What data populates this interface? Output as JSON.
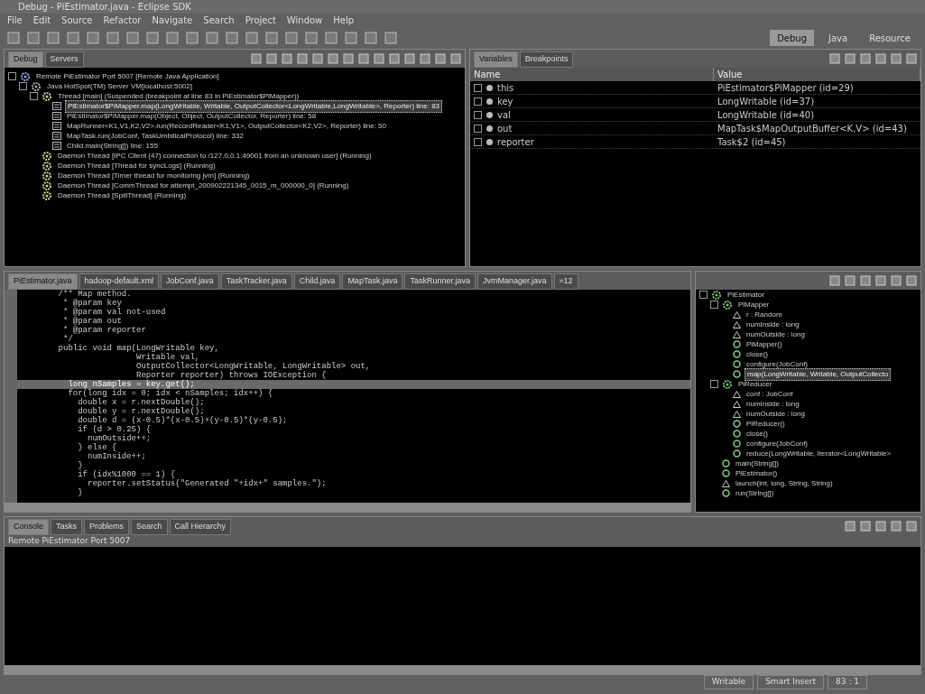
{
  "window": {
    "title": "Debug - PiEstimator.java - Eclipse SDK"
  },
  "menu": [
    "File",
    "Edit",
    "Source",
    "Refactor",
    "Navigate",
    "Search",
    "Project",
    "Window",
    "Help"
  ],
  "perspectives": [
    {
      "label": "Debug",
      "selected": true
    },
    {
      "label": "Java",
      "selected": false
    },
    {
      "label": "Resource",
      "selected": false
    }
  ],
  "debug_view": {
    "tabs": [
      {
        "label": "Debug",
        "selected": true
      },
      {
        "label": "Servers",
        "selected": false
      }
    ],
    "tree": [
      {
        "kind": "launch",
        "text": "Remote PiEstimator Port 5007 [Remote Java Application]",
        "selected": false,
        "children": [
          {
            "kind": "vm",
            "text": "Java HotSpot(TM) Server VM[localhost:5002]",
            "selected": false,
            "children": [
              {
                "kind": "thread",
                "text": "Thread [main] (Suspended (breakpoint at line 83 in PiEstimator$PiMapper))",
                "selected": false,
                "children": [
                  {
                    "kind": "frame",
                    "text": "PiEstimator$PiMapper.map(LongWritable, Writable, OutputCollector<LongWritable,LongWritable>, Reporter) line: 83",
                    "selected": true
                  },
                  {
                    "kind": "frame",
                    "text": "PiEstimator$PiMapper.map(Object, Object, OutputCollector, Reporter) line: 58",
                    "selected": false
                  },
                  {
                    "kind": "frame",
                    "text": "MapRunner<K1,V1,K2,V2>.run(RecordReader<K1,V1>, OutputCollector<K2,V2>, Reporter) line: 50",
                    "selected": false
                  },
                  {
                    "kind": "frame",
                    "text": "MapTask.run(JobConf, TaskUmbilicalProtocol) line: 332",
                    "selected": false
                  },
                  {
                    "kind": "frame",
                    "text": "Child.main(String[]) line: 155",
                    "selected": false
                  }
                ]
              },
              {
                "kind": "thread",
                "text": "Daemon Thread [IPC Client (47) connection to /127.0.0.1:49001 from an unknown user] (Running)",
                "selected": false
              },
              {
                "kind": "thread",
                "text": "Daemon Thread [Thread for syncLogs] (Running)",
                "selected": false
              },
              {
                "kind": "thread",
                "text": "Daemon Thread [Timer thread for monitoring jvm] (Running)",
                "selected": false
              },
              {
                "kind": "thread",
                "text": "Daemon Thread [CommThread for attempt_200902221345_0015_m_000000_0] (Running)",
                "selected": false
              },
              {
                "kind": "thread",
                "text": "Daemon Thread [SpillThread] (Running)",
                "selected": false
              }
            ]
          }
        ]
      }
    ]
  },
  "variables_view": {
    "tabs": [
      {
        "label": "Variables",
        "selected": true
      },
      {
        "label": "Breakpoints",
        "selected": false
      }
    ],
    "columns": [
      "Name",
      "Value"
    ],
    "rows": [
      {
        "name": "this",
        "value": "PiEstimator$PiMapper (id=29)"
      },
      {
        "name": "key",
        "value": "LongWritable (id=37)"
      },
      {
        "name": "val",
        "value": "LongWritable (id=40)"
      },
      {
        "name": "out",
        "value": "MapTask$MapOutputBuffer<K,V> (id=43)"
      },
      {
        "name": "reporter",
        "value": "Task$2 (id=45)"
      }
    ]
  },
  "editor": {
    "tabs": [
      {
        "label": "PiEstimator.java",
        "selected": true
      },
      {
        "label": "hadoop-default.xml",
        "selected": false
      },
      {
        "label": "JobConf.java",
        "selected": false
      },
      {
        "label": "TaskTracker.java",
        "selected": false
      },
      {
        "label": "Child.java",
        "selected": false
      },
      {
        "label": "MapTask.java",
        "selected": false
      },
      {
        "label": "TaskRunner.java",
        "selected": false
      },
      {
        "label": "JvmManager.java",
        "selected": false
      },
      {
        "label": "»12",
        "selected": false
      }
    ],
    "lines": [
      {
        "text": "    /** Map method.",
        "current": false
      },
      {
        "text": "     * @param key",
        "current": false
      },
      {
        "text": "     * @param val not-used",
        "current": false
      },
      {
        "text": "     * @param out",
        "current": false
      },
      {
        "text": "     * @param reporter",
        "current": false
      },
      {
        "text": "     */",
        "current": false
      },
      {
        "text": "    public void map(LongWritable key,",
        "current": false
      },
      {
        "text": "                    Writable val,",
        "current": false
      },
      {
        "text": "                    OutputCollector<LongWritable, LongWritable> out,",
        "current": false
      },
      {
        "text": "                    Reporter reporter) throws IOException {",
        "current": false
      },
      {
        "text": "      long nSamples = key.get();",
        "current": true
      },
      {
        "text": "      for(long idx = 0; idx < nSamples; idx++) {",
        "current": false
      },
      {
        "text": "        double x = r.nextDouble();",
        "current": false
      },
      {
        "text": "        double y = r.nextDouble();",
        "current": false
      },
      {
        "text": "        double d = (x-0.5)*(x-0.5)+(y-0.5)*(y-0.5);",
        "current": false
      },
      {
        "text": "        if (d > 0.25) {",
        "current": false
      },
      {
        "text": "          numOutside++;",
        "current": false
      },
      {
        "text": "        } else {",
        "current": false
      },
      {
        "text": "          numInside++;",
        "current": false
      },
      {
        "text": "        }",
        "current": false
      },
      {
        "text": "        if (idx%1000 == 1) {",
        "current": false
      },
      {
        "text": "          reporter.setStatus(\"Generated \"+idx+\" samples.\");",
        "current": false
      },
      {
        "text": "        }",
        "current": false
      }
    ]
  },
  "outline": {
    "tree": [
      {
        "kind": "class",
        "text": "PiEstimator",
        "selected": false,
        "children": [
          {
            "kind": "class",
            "text": "PiMapper",
            "selected": false,
            "children": [
              {
                "kind": "field",
                "text": "r : Random",
                "selected": false
              },
              {
                "kind": "field",
                "text": "numInside : long",
                "selected": false
              },
              {
                "kind": "field",
                "text": "numOutside : long",
                "selected": false
              },
              {
                "kind": "method",
                "text": "PiMapper()",
                "selected": false
              },
              {
                "kind": "method",
                "text": "close()",
                "selected": false
              },
              {
                "kind": "method",
                "text": "configure(JobConf)",
                "selected": false
              },
              {
                "kind": "method",
                "text": "map(LongWritable, Writable, OutputCollecto",
                "selected": true
              }
            ]
          },
          {
            "kind": "class",
            "text": "PiReducer",
            "selected": false,
            "children": [
              {
                "kind": "field",
                "text": "conf : JobConf",
                "selected": false
              },
              {
                "kind": "field",
                "text": "numInside : long",
                "selected": false
              },
              {
                "kind": "field",
                "text": "numOutside : long",
                "selected": false
              },
              {
                "kind": "method",
                "text": "PiReducer()",
                "selected": false
              },
              {
                "kind": "method",
                "text": "close()",
                "selected": false
              },
              {
                "kind": "method",
                "text": "configure(JobConf)",
                "selected": false
              },
              {
                "kind": "method",
                "text": "reduce(LongWritable, Iterator<LongWritable>",
                "selected": false
              }
            ]
          },
          {
            "kind": "method",
            "text": "main(String[])",
            "selected": false
          },
          {
            "kind": "method",
            "text": "PiEstimator()",
            "selected": false
          },
          {
            "kind": "field",
            "text": "launch(int, long, String, String)",
            "selected": false
          },
          {
            "kind": "method",
            "text": "run(String[])",
            "selected": false
          }
        ]
      }
    ]
  },
  "console_view": {
    "tabs": [
      {
        "label": "Console",
        "selected": true
      },
      {
        "label": "Tasks",
        "selected": false
      },
      {
        "label": "Problems",
        "selected": false
      },
      {
        "label": "Search",
        "selected": false
      },
      {
        "label": "Call Hierarchy",
        "selected": false
      }
    ],
    "subtitle": "Remote PiEstimator Port 5007"
  },
  "status_bar": [
    "Writable",
    "Smart Insert",
    "83 : 1"
  ]
}
